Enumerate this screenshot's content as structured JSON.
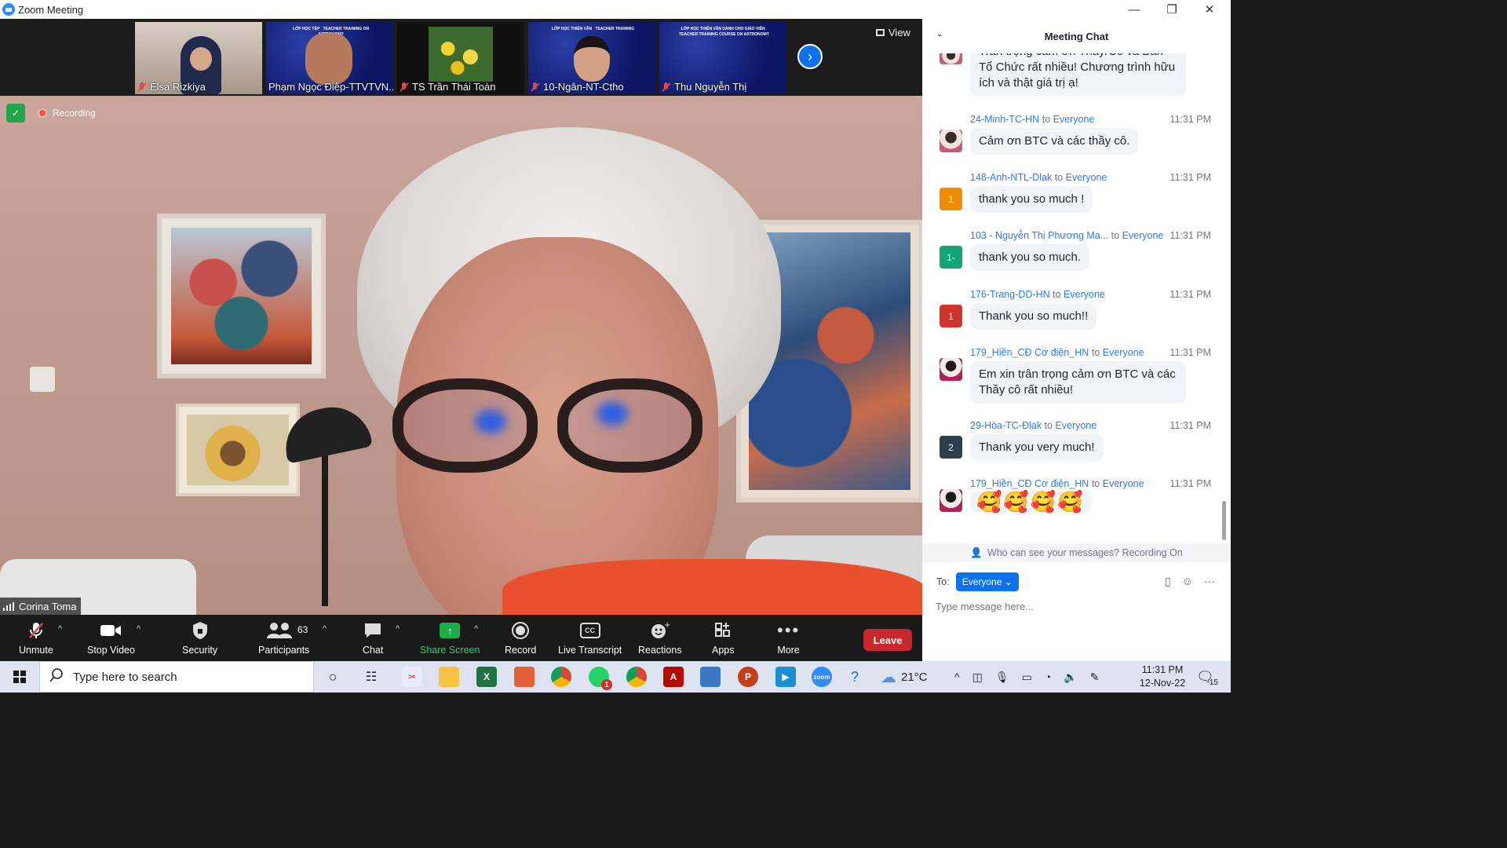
{
  "window": {
    "title": "Zoom Meeting"
  },
  "strip": {
    "participants": [
      {
        "name": "Elsa Rizkiya",
        "muted": true
      },
      {
        "name": "Phạm Ngọc Điệp-TTVTVN...",
        "muted": false
      },
      {
        "name": "TS Trần Thái Toàn",
        "muted": true
      },
      {
        "name": "10-Ngân-NT-Ctho",
        "muted": true
      },
      {
        "name": "Thu Nguyễn Thị",
        "muted": true
      }
    ],
    "view_label": "View"
  },
  "main": {
    "recording_label": "Recording",
    "speaker_name": "Corina Toma"
  },
  "toolbar": {
    "unmute": "Unmute",
    "stop_video": "Stop Video",
    "security": "Security",
    "participants": "Participants",
    "participants_count": "63",
    "chat": "Chat",
    "share_screen": "Share Screen",
    "record": "Record",
    "live_transcript": "Live Transcript",
    "reactions": "Reactions",
    "apps": "Apps",
    "more": "More",
    "leave": "Leave",
    "share_color": "#1fad4a",
    "leave_color": "#c7272f"
  },
  "chat": {
    "title": "Meeting Chat",
    "partial_text": "Trân trọng cảm ơn Thầy/Cô và Ban Tổ Chức rất nhiều! Chương trình hữu ích và thật giá trị ạ!",
    "messages": [
      {
        "sender": "24-Minh-TC-HN",
        "to_word": "to",
        "to": "Everyone",
        "time": "11:31 PM",
        "avatar": "",
        "text": "Cảm ơn BTC và các thầy cô."
      },
      {
        "sender": "148-Anh-NTL-Dlak",
        "to_word": "to",
        "to": "Everyone",
        "time": "11:31 PM",
        "avatar": "1",
        "text": "thank you so much !"
      },
      {
        "sender": "103 - Nguyễn Thị Phương Ma...",
        "to_word": "to",
        "to": "Everyone",
        "time": "11:31 PM",
        "avatar": "1-",
        "text": "thank you so much."
      },
      {
        "sender": "176-Trang-DD-HN",
        "to_word": "to",
        "to": "Everyone",
        "time": "11:31 PM",
        "avatar": "1",
        "text": "Thank you so much!!"
      },
      {
        "sender": "179_Hiền_CĐ Cơ điện_HN",
        "to_word": "to",
        "to": "Everyone",
        "time": "11:31 PM",
        "avatar": "",
        "text": "Em xin trân trọng cảm ơn BTC và các Thầy cô rất nhiều!"
      },
      {
        "sender": "29-Hòa-TC-Đlak",
        "to_word": "to",
        "to": "Everyone",
        "time": "11:31 PM",
        "avatar": "2",
        "text": "Thank you very much!"
      },
      {
        "sender": "179_Hiền_CĐ Cơ điện_HN",
        "to_word": "to",
        "to": "Everyone",
        "time": "11:31 PM",
        "avatar": "",
        "text": "🥰🥰🥰🥰"
      }
    ],
    "avatar_colors": [
      "#f08c00",
      "#12a575",
      "#d0342c",
      "#2d3e50"
    ],
    "notice": "Who can see your messages? Recording On",
    "to_label": "To:",
    "to_value": "Everyone",
    "input_placeholder": "Type message here..."
  },
  "taskbar": {
    "search_placeholder": "Type here to search",
    "weather": "21°C",
    "time": "11:31 PM",
    "date": "12-Nov-22",
    "badge_whatsapp": "1",
    "notif_count": "15"
  }
}
